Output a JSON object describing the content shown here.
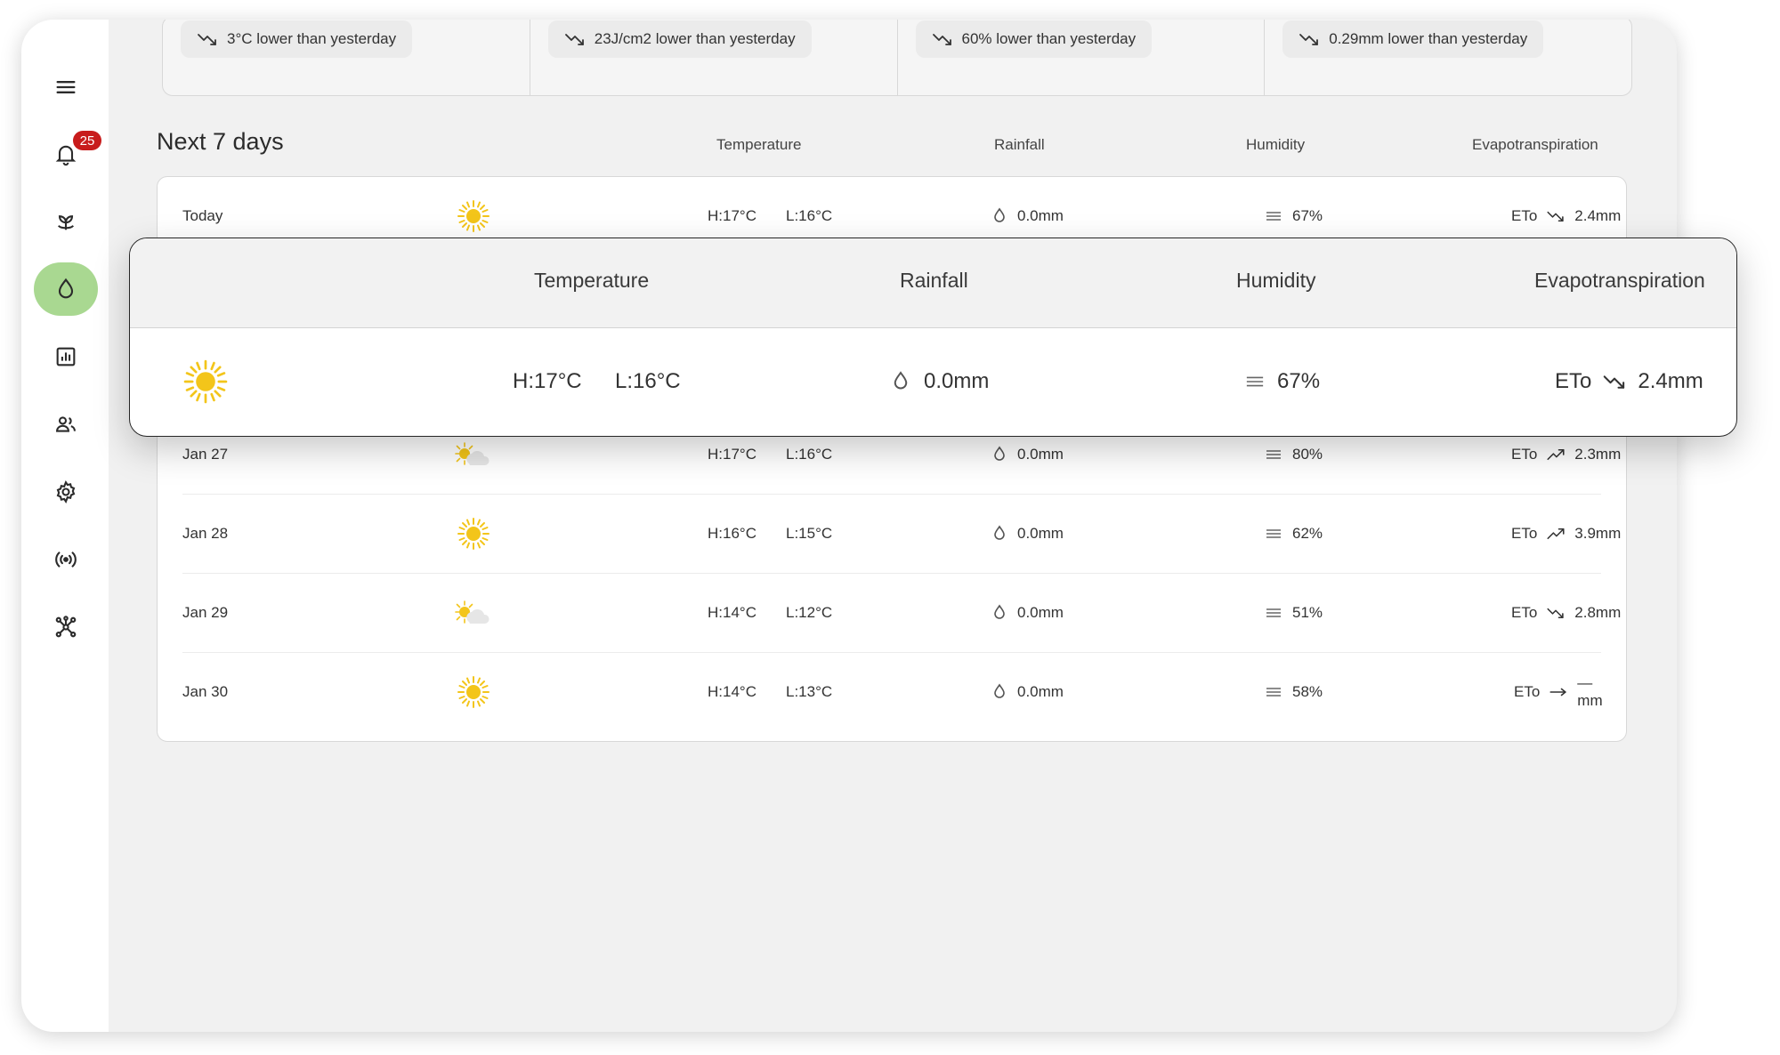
{
  "sidebar": {
    "notification_count": "25",
    "items": [
      {
        "icon": "menu-icon"
      },
      {
        "icon": "bell-icon"
      },
      {
        "icon": "plant-icon"
      },
      {
        "icon": "water-drop-icon",
        "active": true
      },
      {
        "icon": "chart-icon"
      },
      {
        "icon": "users-icon"
      },
      {
        "icon": "gear-icon"
      },
      {
        "icon": "radio-signal-icon"
      },
      {
        "icon": "network-icon"
      }
    ],
    "accent_color": "#a9d891"
  },
  "summary_cards": [
    {
      "trend": "down",
      "text": "3°C lower than yesterday"
    },
    {
      "trend": "down",
      "text": "23J/cm2 lower than yesterday"
    },
    {
      "trend": "down",
      "text": "60% lower than yesterday"
    },
    {
      "trend": "down",
      "text": "0.29mm lower than yesterday"
    }
  ],
  "forecast": {
    "title": "Next 7 days",
    "columns": {
      "temperature": "Temperature",
      "rainfall": "Rainfall",
      "humidity": "Humidity",
      "evapotranspiration": "Evapotranspiration"
    },
    "eto_label": "ETo",
    "rows": [
      {
        "day": "Today",
        "weather": "sunny",
        "high": "H:17°C",
        "low": "L:16°C",
        "rain": "0.0mm",
        "humidity": "67%",
        "eto_trend": "down",
        "eto": "2.4mm"
      },
      {
        "day": "Jan 27",
        "weather": "partly-cloudy",
        "high": "H:17°C",
        "low": "L:16°C",
        "rain": "0.0mm",
        "humidity": "80%",
        "eto_trend": "up",
        "eto": "2.3mm"
      },
      {
        "day": "Jan 28",
        "weather": "sunny",
        "high": "H:16°C",
        "low": "L:15°C",
        "rain": "0.0mm",
        "humidity": "62%",
        "eto_trend": "up",
        "eto": "3.9mm"
      },
      {
        "day": "Jan 29",
        "weather": "partly-cloudy",
        "high": "H:14°C",
        "low": "L:12°C",
        "rain": "0.0mm",
        "humidity": "51%",
        "eto_trend": "down",
        "eto": "2.8mm"
      },
      {
        "day": "Jan 30",
        "weather": "sunny",
        "high": "H:14°C",
        "low": "L:13°C",
        "rain": "0.0mm",
        "humidity": "58%",
        "eto_trend": "flat",
        "eto": "— mm"
      }
    ]
  },
  "popup": {
    "columns": {
      "temperature": "Temperature",
      "rainfall": "Rainfall",
      "humidity": "Humidity",
      "evapotranspiration": "Evapotranspiration"
    },
    "row": {
      "weather": "sunny",
      "high": "H:17°C",
      "low": "L:16°C",
      "rain": "0.0mm",
      "humidity": "67%",
      "eto_label": "ETo",
      "eto_trend": "down",
      "eto": "2.4mm"
    }
  }
}
